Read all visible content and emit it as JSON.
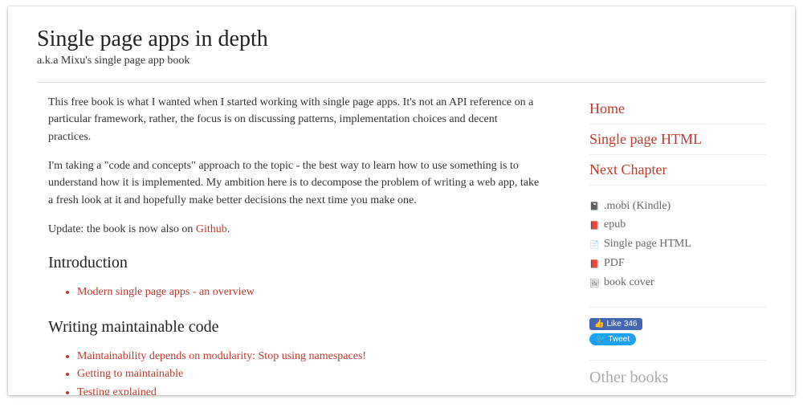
{
  "header": {
    "title": "Single page apps in depth",
    "subtitle": "a.k.a Mixu's single page app book"
  },
  "main": {
    "intro_p1": "This free book is what I wanted when I started working with single page apps. It's not an API reference on a particular framework, rather, the focus is on discussing patterns, implementation choices and decent practices.",
    "intro_p2": "I'm taking a \"code and concepts\" approach to the topic - the best way to learn how to use something is to understand how it is implemented. My ambition here is to decompose the problem of writing a web app, take a fresh look at it and hopefully make better decisions the next time you make one.",
    "update_prefix": "Update: the book is now also on ",
    "update_link": "Github",
    "update_suffix": ".",
    "section1": {
      "heading": "Introduction",
      "items": [
        "Modern single page apps - an overview"
      ]
    },
    "section2": {
      "heading": "Writing maintainable code",
      "items": [
        "Maintainability depends on modularity: Stop using namespaces!",
        "Getting to maintainable",
        "Testing explained"
      ]
    }
  },
  "sidebar": {
    "nav": [
      "Home",
      "Single page HTML",
      "Next Chapter"
    ],
    "downloads": [
      {
        "icon": "📓",
        "label": ".mobi (Kindle)"
      },
      {
        "icon": "📕",
        "label": "epub"
      },
      {
        "icon": "📄",
        "label": "Single page HTML"
      },
      {
        "icon": "📕",
        "label": "PDF"
      },
      {
        "icon": "🖼",
        "label": "book cover"
      }
    ],
    "social": {
      "fb_label": "Like",
      "fb_count": "346",
      "tweet_label": "Tweet"
    },
    "other_books_heading": "Other books"
  }
}
